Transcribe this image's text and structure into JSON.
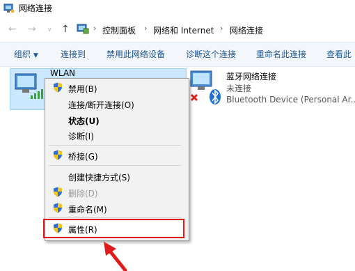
{
  "window": {
    "title": "网络连接"
  },
  "address": {
    "crumbs": [
      "控制面板",
      "网络和 Internet",
      "网络连接"
    ]
  },
  "toolbar": {
    "organize": "组织",
    "connect_to": "连接到",
    "disable": "禁用此网络设备",
    "diagnose": "诊断这个连接",
    "rename": "重命名此连接",
    "view": "查看此"
  },
  "adapters": {
    "wlan": {
      "name": "WLAN"
    },
    "bluetooth": {
      "name": "蓝牙网络连接",
      "status": "未连接",
      "device": "Bluetooth Device (Personal Ar..."
    }
  },
  "context_menu": {
    "items": [
      {
        "label": "禁用(B)"
      },
      {
        "label": "连接/断开连接(O)"
      },
      {
        "label": "状态(U)"
      },
      {
        "label": "诊断(I)"
      },
      {
        "label": "桥接(G)"
      },
      {
        "label": "创建快捷方式(S)"
      },
      {
        "label": "删除(D)"
      },
      {
        "label": "重命名(M)"
      },
      {
        "label": "属性(R)"
      }
    ]
  },
  "colors": {
    "annotation": "#e01b1b",
    "toolbar_link": "#1d5a98",
    "selection": "#cce8ff"
  }
}
